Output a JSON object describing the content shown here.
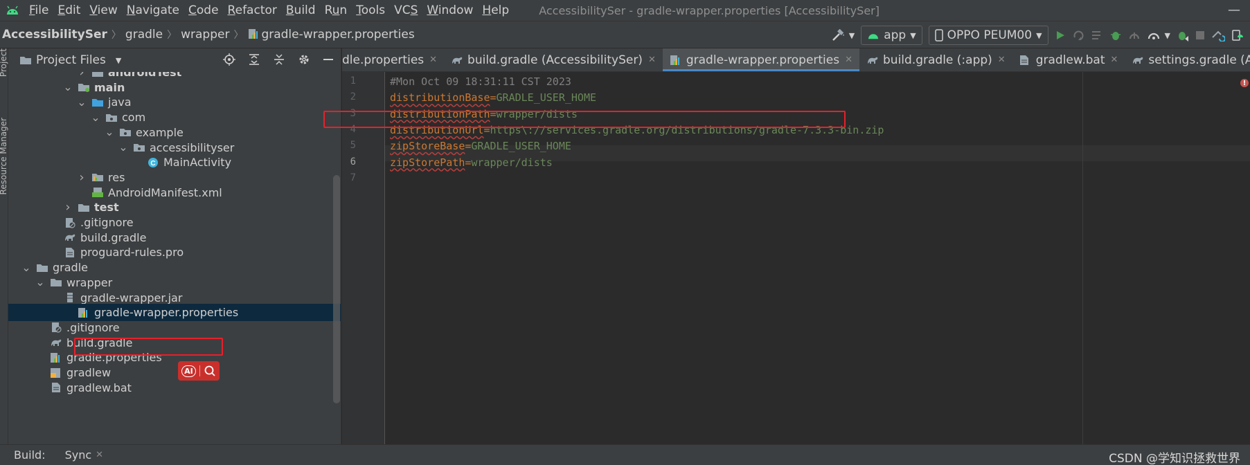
{
  "menubar": {
    "items": [
      "File",
      "Edit",
      "View",
      "Navigate",
      "Code",
      "Refactor",
      "Build",
      "Run",
      "Tools",
      "VCS",
      "Window",
      "Help"
    ],
    "mnemonics": [
      "F",
      "E",
      "V",
      "N",
      "C",
      "R",
      "B",
      "u",
      "T",
      "S",
      "W",
      "H"
    ],
    "window_title": "AccessibilitySer - gradle-wrapper.properties [AccessibilitySer]"
  },
  "navbar": {
    "breadcrumbs": [
      "AccessibilitySer",
      "gradle",
      "wrapper",
      "gradle-wrapper.properties"
    ],
    "run_config": "app",
    "device": "OPPO PEUM00"
  },
  "left_strip": {
    "project_label": "Project",
    "resource_label": "Resource Manager"
  },
  "project_panel": {
    "title": "Project Files",
    "tree": [
      {
        "label": "androidTest",
        "bold": true,
        "arrow": "right",
        "icon": "folder-icon"
      },
      {
        "label": "main",
        "bold": true,
        "arrow": "down",
        "icon": "module-folder-icon"
      },
      {
        "label": "java",
        "bold": false,
        "arrow": "down",
        "icon": "source-folder-icon"
      },
      {
        "label": "com",
        "bold": false,
        "arrow": "down",
        "icon": "package-icon"
      },
      {
        "label": "example",
        "bold": false,
        "arrow": "down",
        "icon": "package-icon"
      },
      {
        "label": "accessibilityser",
        "bold": false,
        "arrow": "down",
        "icon": "package-icon"
      },
      {
        "label": "MainActivity",
        "bold": false,
        "arrow": "",
        "icon": "class-icon"
      },
      {
        "label": "res",
        "bold": false,
        "arrow": "right",
        "icon": "resource-folder-icon"
      },
      {
        "label": "AndroidManifest.xml",
        "bold": false,
        "arrow": "",
        "icon": "manifest-icon"
      },
      {
        "label": "test",
        "bold": true,
        "arrow": "right",
        "icon": "folder-icon"
      },
      {
        "label": ".gitignore",
        "bold": false,
        "arrow": "",
        "icon": "gitignore-icon"
      },
      {
        "label": "build.gradle",
        "bold": false,
        "arrow": "",
        "icon": "gradle-icon"
      },
      {
        "label": "proguard-rules.pro",
        "bold": false,
        "arrow": "",
        "icon": "file-icon"
      },
      {
        "label": "gradle",
        "bold": false,
        "arrow": "down",
        "icon": "folder-icon"
      },
      {
        "label": "wrapper",
        "bold": false,
        "arrow": "down",
        "icon": "folder-icon"
      },
      {
        "label": "gradle-wrapper.jar",
        "bold": false,
        "arrow": "",
        "icon": "jar-icon"
      },
      {
        "label": "gradle-wrapper.properties",
        "bold": false,
        "arrow": "",
        "icon": "properties-icon",
        "selected": true
      },
      {
        "label": ".gitignore",
        "bold": false,
        "arrow": "",
        "icon": "gitignore-icon"
      },
      {
        "label": "build.gradle",
        "bold": false,
        "arrow": "",
        "icon": "gradle-icon"
      },
      {
        "label": "gradle.properties",
        "bold": false,
        "arrow": "",
        "icon": "properties-icon"
      },
      {
        "label": "gradlew",
        "bold": false,
        "arrow": "",
        "icon": "shell-script-icon"
      },
      {
        "label": "gradlew.bat",
        "bold": false,
        "arrow": "",
        "icon": "file-icon"
      }
    ]
  },
  "ai_badge": {
    "label": "AI"
  },
  "tabs": [
    {
      "label": "dle.properties",
      "icon": "",
      "active": false
    },
    {
      "label": "build.gradle (AccessibilitySer)",
      "icon": "gradle-icon",
      "active": false
    },
    {
      "label": "gradle-wrapper.properties",
      "icon": "properties-icon",
      "active": true
    },
    {
      "label": "build.gradle (:app)",
      "icon": "gradle-icon",
      "active": false
    },
    {
      "label": "gradlew.bat",
      "icon": "file-icon",
      "active": false
    },
    {
      "label": "settings.gradle (AccessibilitySer)",
      "icon": "gradle-icon",
      "active": false
    }
  ],
  "editor": {
    "lines": [
      {
        "num": "1",
        "comment": "#Mon Oct 09 18:31:11 CST 2023"
      },
      {
        "num": "2",
        "key": "distributionBase",
        "value": "GRADLE_USER_HOME"
      },
      {
        "num": "3",
        "key": "distributionPath",
        "value": "wrapper/dists"
      },
      {
        "num": "4",
        "key": "distributionUrl",
        "value": "https\\://services.gradle.org/distributions/gradle-7.3.3-bin.zip"
      },
      {
        "num": "5",
        "key": "zipStoreBase",
        "value": "GRADLE_USER_HOME"
      },
      {
        "num": "6",
        "key": "zipStorePath",
        "value": "wrapper/dists",
        "current": true
      },
      {
        "num": "7"
      }
    ]
  },
  "statusbar": {
    "build_label": "Build:",
    "sync_label": "Sync",
    "watermark": "CSDN @学知识拯救世界"
  },
  "colors": {
    "highlight_red": "#e8202a",
    "selection_blue": "#0d293e",
    "active_tab_underline": "#4a88c7",
    "property_key": "#cc7832",
    "property_value": "#6a8759",
    "comment": "#808080"
  }
}
